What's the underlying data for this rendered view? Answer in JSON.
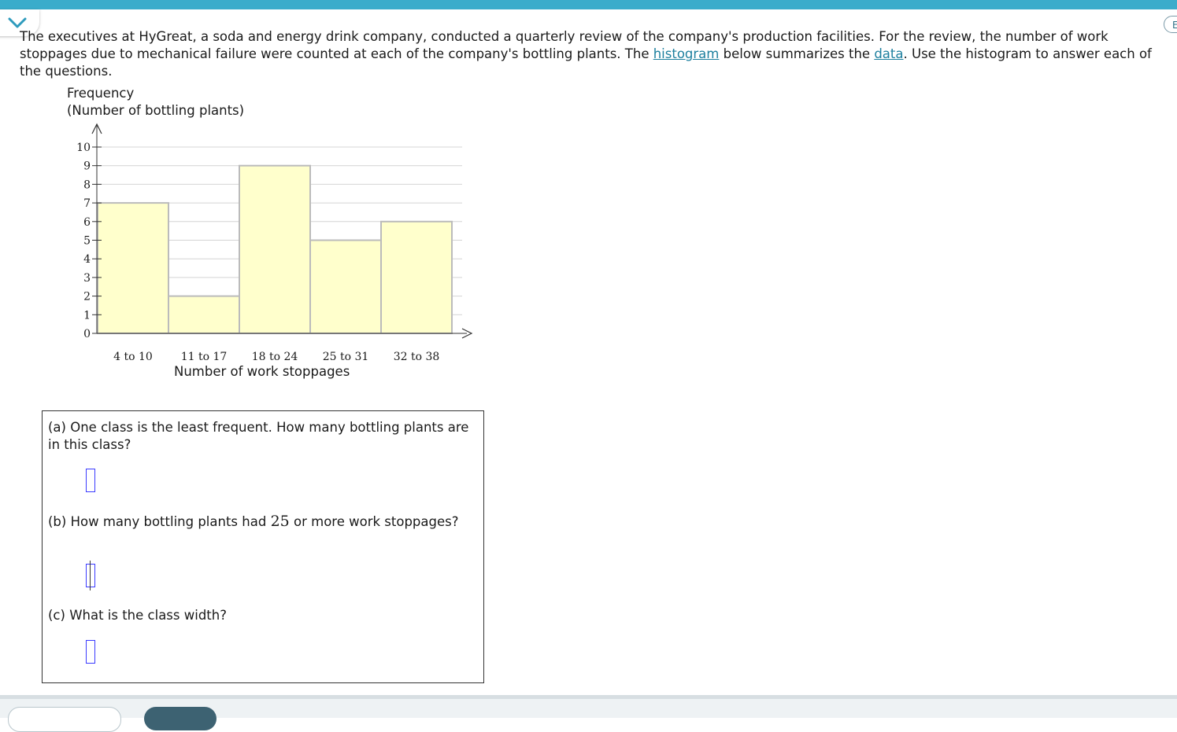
{
  "intro": {
    "part1": "The executives at HyGreat, a soda and energy drink company, conducted a quarterly review of the company's production facilities. For the review, the number of work stoppages due to mechanical failure were counted at each of the company's bottling plants. The ",
    "link1": "histogram",
    "part2": " below summarizes the ",
    "link2": "data",
    "part3": ". Use the histogram to answer each of the questions."
  },
  "side_button_label": "E",
  "chart_data": {
    "type": "bar",
    "title": "",
    "ylabel_line1": "Frequency",
    "ylabel_line2": "(Number of bottling plants)",
    "xlabel": "Number of work stoppages",
    "categories": [
      "4 to 10",
      "11 to 17",
      "18 to 24",
      "25 to 31",
      "32 to 38"
    ],
    "values": [
      7,
      2,
      9,
      5,
      6
    ],
    "ylim": [
      0,
      10
    ],
    "yticks": [
      "0",
      "1",
      "2",
      "3",
      "4",
      "5",
      "6",
      "7",
      "8",
      "9",
      "10"
    ],
    "grid": true,
    "bar_color": "#ffffcc",
    "bar_edge_color": "#bbbbbb"
  },
  "questions": {
    "a_text": "(a) One class is the least frequent. How many bottling plants are in this class?",
    "b_text_pre": "(b) How many bottling plants had ",
    "b_number": "25",
    "b_text_post": " or more work stoppages?",
    "c_text": "(c) What is the class width?"
  },
  "answers": {
    "a_value": "",
    "b_value": "",
    "c_value": ""
  },
  "colors": {
    "accent": "#3aaccb",
    "link": "#1c7f9e",
    "input_border": "#3a3aff"
  }
}
